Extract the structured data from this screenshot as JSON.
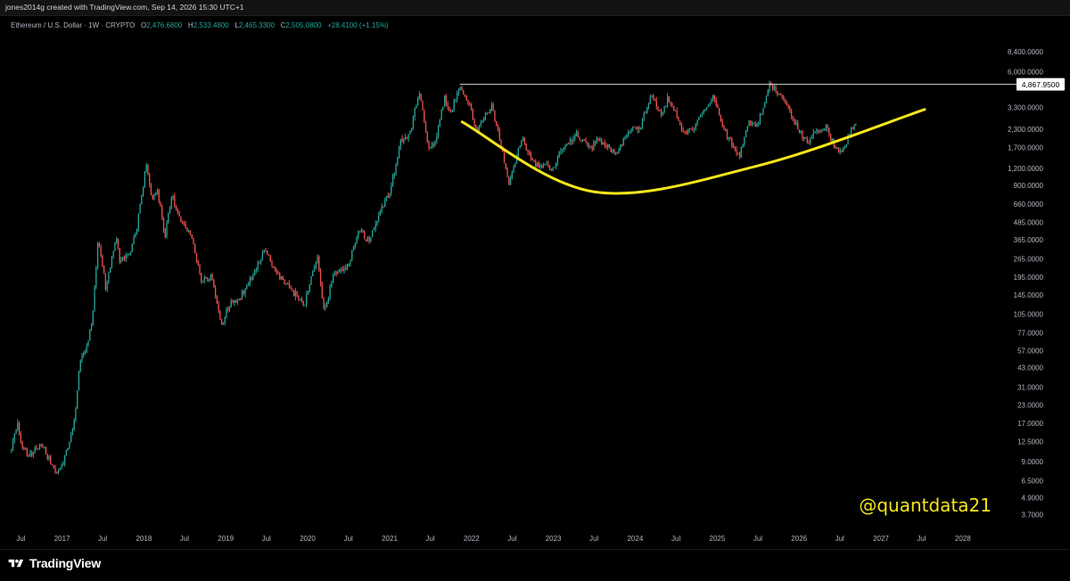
{
  "header": {
    "credit": "jones2014g created with TradingView.com, Sep 14, 2026 15:30 UTC+1"
  },
  "legend": {
    "symbol": "Ethereum / U.S. Dollar · 1W · CRYPTO",
    "open_label": "O",
    "open": "2,476.6800",
    "high_label": "H",
    "high": "2,533.4800",
    "low_label": "L",
    "low": "2,465.3300",
    "close_label": "C",
    "close": "2,505.0800",
    "change": "+28.4100 (+1.15%)"
  },
  "watermark": "@quantdata21",
  "footer": {
    "brand": "TradingView"
  },
  "colors": {
    "up": "#26a69a",
    "down": "#ef5350",
    "curve": "#f5e51b",
    "resistance": "#d1d4dc",
    "watermark": "#f5e51b"
  },
  "chart_data": {
    "type": "candlestick",
    "y_scale": "log",
    "ylim": [
      2.9,
      13500
    ],
    "xlim": [
      "2016-05-01",
      "2028-06-01"
    ],
    "y_ticks": [
      {
        "value": 8400,
        "label": "8,400.0000"
      },
      {
        "value": 6000,
        "label": "6,000.0000"
      },
      {
        "value": 3300,
        "label": "3,300.0000"
      },
      {
        "value": 2300,
        "label": "2,300.0000"
      },
      {
        "value": 1700,
        "label": "1,700.0000"
      },
      {
        "value": 1200,
        "label": "1,200.0000"
      },
      {
        "value": 900,
        "label": "900.0000"
      },
      {
        "value": 660,
        "label": "660.0000"
      },
      {
        "value": 485,
        "label": "485.0000"
      },
      {
        "value": 365,
        "label": "365.0000"
      },
      {
        "value": 265,
        "label": "265.0000"
      },
      {
        "value": 195,
        "label": "195.0000"
      },
      {
        "value": 145,
        "label": "145.0000"
      },
      {
        "value": 105,
        "label": "105.0000"
      },
      {
        "value": 77,
        "label": "77.0000"
      },
      {
        "value": 57,
        "label": "57.0000"
      },
      {
        "value": 43,
        "label": "43.0000"
      },
      {
        "value": 31,
        "label": "31.0000"
      },
      {
        "value": 23,
        "label": "23.0000"
      },
      {
        "value": 17,
        "label": "17.0000"
      },
      {
        "value": 12.5,
        "label": "12.5000"
      },
      {
        "value": 9,
        "label": "9.0000"
      },
      {
        "value": 6.5,
        "label": "6.5000"
      },
      {
        "value": 4.9,
        "label": "4.9000"
      },
      {
        "value": 3.7,
        "label": "3.7000"
      }
    ],
    "x_ticks": [
      {
        "date": "2016-07-01",
        "label": "Jul"
      },
      {
        "date": "2017-01-01",
        "label": "2017"
      },
      {
        "date": "2017-07-01",
        "label": "Jul"
      },
      {
        "date": "2018-01-01",
        "label": "2018"
      },
      {
        "date": "2018-07-01",
        "label": "Jul"
      },
      {
        "date": "2019-01-01",
        "label": "2019"
      },
      {
        "date": "2019-07-01",
        "label": "Jul"
      },
      {
        "date": "2020-01-01",
        "label": "2020"
      },
      {
        "date": "2020-07-01",
        "label": "Jul"
      },
      {
        "date": "2021-01-01",
        "label": "2021"
      },
      {
        "date": "2021-07-01",
        "label": "Jul"
      },
      {
        "date": "2022-01-01",
        "label": "2022"
      },
      {
        "date": "2022-07-01",
        "label": "Jul"
      },
      {
        "date": "2023-01-01",
        "label": "2023"
      },
      {
        "date": "2023-07-01",
        "label": "Jul"
      },
      {
        "date": "2024-01-01",
        "label": "2024"
      },
      {
        "date": "2024-07-01",
        "label": "Jul"
      },
      {
        "date": "2025-01-01",
        "label": "2025"
      },
      {
        "date": "2025-07-01",
        "label": "Jul"
      },
      {
        "date": "2026-01-01",
        "label": "2026"
      },
      {
        "date": "2026-07-01",
        "label": "Jul"
      },
      {
        "date": "2027-01-01",
        "label": "2027"
      },
      {
        "date": "2027-07-01",
        "label": "Jul"
      },
      {
        "date": "2028-01-01",
        "label": "2028"
      }
    ],
    "price_path": [
      [
        "2016-05-20",
        11
      ],
      [
        "2016-06-17",
        18
      ],
      [
        "2016-07-01",
        12
      ],
      [
        "2016-08-01",
        10
      ],
      [
        "2016-10-01",
        12
      ],
      [
        "2016-12-05",
        7.5
      ],
      [
        "2016-12-20",
        7.8
      ],
      [
        "2017-02-01",
        12
      ],
      [
        "2017-03-01",
        20
      ],
      [
        "2017-03-20",
        45
      ],
      [
        "2017-04-20",
        60
      ],
      [
        "2017-05-15",
        95
      ],
      [
        "2017-06-12",
        380
      ],
      [
        "2017-07-15",
        160
      ],
      [
        "2017-08-01",
        230
      ],
      [
        "2017-09-01",
        380
      ],
      [
        "2017-09-15",
        260
      ],
      [
        "2017-11-01",
        300
      ],
      [
        "2017-12-01",
        450
      ],
      [
        "2018-01-12",
        1300
      ],
      [
        "2018-02-06",
        700
      ],
      [
        "2018-03-01",
        850
      ],
      [
        "2018-04-05",
        380
      ],
      [
        "2018-05-05",
        780
      ],
      [
        "2018-06-01",
        550
      ],
      [
        "2018-08-01",
        400
      ],
      [
        "2018-09-12",
        180
      ],
      [
        "2018-11-01",
        200
      ],
      [
        "2018-12-14",
        85
      ],
      [
        "2019-01-15",
        125
      ],
      [
        "2019-03-01",
        135
      ],
      [
        "2019-05-01",
        200
      ],
      [
        "2019-06-26",
        320
      ],
      [
        "2019-08-01",
        220
      ],
      [
        "2019-10-01",
        170
      ],
      [
        "2019-12-18",
        125
      ],
      [
        "2020-02-14",
        280
      ],
      [
        "2020-03-13",
        110
      ],
      [
        "2020-05-01",
        210
      ],
      [
        "2020-07-01",
        230
      ],
      [
        "2020-08-15",
        440
      ],
      [
        "2020-10-01",
        350
      ],
      [
        "2020-11-24",
        600
      ],
      [
        "2021-01-01",
        800
      ],
      [
        "2021-02-20",
        1900
      ],
      [
        "2021-04-01",
        2100
      ],
      [
        "2021-05-12",
        4300
      ],
      [
        "2021-06-22",
        1750
      ],
      [
        "2021-07-20",
        1750
      ],
      [
        "2021-09-03",
        3900
      ],
      [
        "2021-09-25",
        2900
      ],
      [
        "2021-11-10",
        4850
      ],
      [
        "2021-12-15",
        3800
      ],
      [
        "2022-01-24",
        2200
      ],
      [
        "2022-03-30",
        3450
      ],
      [
        "2022-05-12",
        1800
      ],
      [
        "2022-06-18",
        900
      ],
      [
        "2022-08-14",
        2000
      ],
      [
        "2022-10-01",
        1300
      ],
      [
        "2022-12-30",
        1190
      ],
      [
        "2023-02-01",
        1650
      ],
      [
        "2023-04-16",
        2120
      ],
      [
        "2023-06-15",
        1650
      ],
      [
        "2023-07-15",
        1950
      ],
      [
        "2023-10-12",
        1550
      ],
      [
        "2023-12-10",
        2350
      ],
      [
        "2024-01-20",
        2300
      ],
      [
        "2024-03-12",
        4050
      ],
      [
        "2024-05-01",
        2900
      ],
      [
        "2024-05-27",
        3900
      ],
      [
        "2024-08-05",
        2200
      ],
      [
        "2024-09-06",
        2200
      ],
      [
        "2024-12-16",
        4100
      ],
      [
        "2025-02-03",
        2200
      ],
      [
        "2025-04-09",
        1450
      ],
      [
        "2025-05-20",
        2600
      ],
      [
        "2025-07-01",
        2500
      ],
      [
        "2025-08-24",
        4900
      ],
      [
        "2025-11-01",
        3700
      ],
      [
        "2025-12-01",
        2800
      ],
      [
        "2026-02-05",
        1800
      ],
      [
        "2026-04-01",
        2300
      ],
      [
        "2026-05-01",
        2350
      ],
      [
        "2026-06-15",
        1650
      ],
      [
        "2026-07-01",
        1550
      ],
      [
        "2026-08-10",
        2000
      ],
      [
        "2026-08-24",
        2420
      ],
      [
        "2026-09-14",
        2505
      ]
    ],
    "annotations": {
      "resistance": {
        "value": 4867.95,
        "label": "4,867.9500",
        "from": "2021-11-10"
      },
      "rounding_bottom": {
        "points": [
          [
            "2021-11-20",
            2600
          ],
          [
            "2023-07-01",
            810
          ],
          [
            "2025-07-01",
            1250
          ],
          [
            "2027-07-15",
            3200
          ]
        ]
      }
    }
  }
}
